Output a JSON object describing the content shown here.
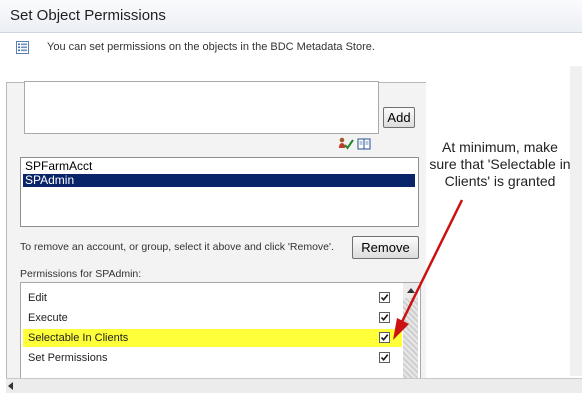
{
  "window": {
    "title": "Set Object Permissions"
  },
  "info": {
    "text": "You can set permissions on the objects in the BDC Metadata Store.",
    "icon": "list-icon"
  },
  "people_picker": {
    "value": "",
    "add_label": "Add",
    "check_names_icon": "check-names-icon",
    "address_book_icon": "address-book-icon"
  },
  "accounts": {
    "items": [
      {
        "label": "SPFarmAcct",
        "selected": false
      },
      {
        "label": "SPAdmin",
        "selected": true
      }
    ]
  },
  "remove": {
    "hint": "To remove an account, or group, select it above and click 'Remove'.",
    "button_label": "Remove"
  },
  "permissions": {
    "label": "Permissions for SPAdmin:",
    "items": [
      {
        "label": "Edit",
        "checked": true,
        "highlighted": false
      },
      {
        "label": "Execute",
        "checked": true,
        "highlighted": false
      },
      {
        "label": "Selectable In Clients",
        "checked": true,
        "highlighted": true
      },
      {
        "label": "Set Permissions",
        "checked": true,
        "highlighted": false
      }
    ]
  },
  "annotation": {
    "text": "At minimum, make sure that 'Selectable in Clients' is granted",
    "color": "#cc1111"
  }
}
